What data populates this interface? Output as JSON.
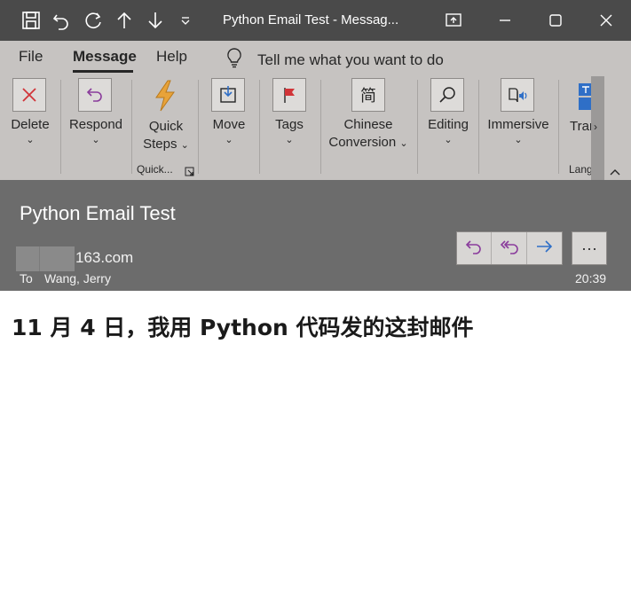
{
  "window": {
    "title": "Python Email Test  -  Messag..."
  },
  "tabs": [
    {
      "label": "File"
    },
    {
      "label": "Message"
    },
    {
      "label": "Help"
    }
  ],
  "tell_me": {
    "label": "Tell me what you want to do"
  },
  "ribbon": {
    "delete": {
      "label": "Delete"
    },
    "respond": {
      "label": "Respond"
    },
    "quick_steps": {
      "line1": "Quick",
      "line2": "Steps"
    },
    "quick_group": {
      "label": "Quick..."
    },
    "move": {
      "label": "Move"
    },
    "tags": {
      "label": "Tags"
    },
    "chinese_conversion": {
      "line1": "Chinese",
      "line2": "Conversion",
      "icon_char": "简"
    },
    "editing": {
      "label": "Editing"
    },
    "immersive": {
      "label": "Immersive"
    },
    "translate": {
      "label": "Tran"
    },
    "lang_group": {
      "label": "Lang"
    }
  },
  "message": {
    "subject": "Python Email Test",
    "sender": "163.com",
    "to_label": "To",
    "to_name": "Wang, Jerry",
    "time": "20:39",
    "more_label": "···"
  },
  "body": {
    "text": "11 月 4 日，我用 Python 代码发的这封邮件"
  },
  "colors": {
    "titlebar": "#4a4a4a",
    "ribbon": "#c6c3c1",
    "header": "#6c6c6c",
    "delete_red": "#d13438",
    "respond_purple": "#8a3c9c",
    "quick_orange": "#e8a33a",
    "forward_blue": "#2f6fc7"
  }
}
